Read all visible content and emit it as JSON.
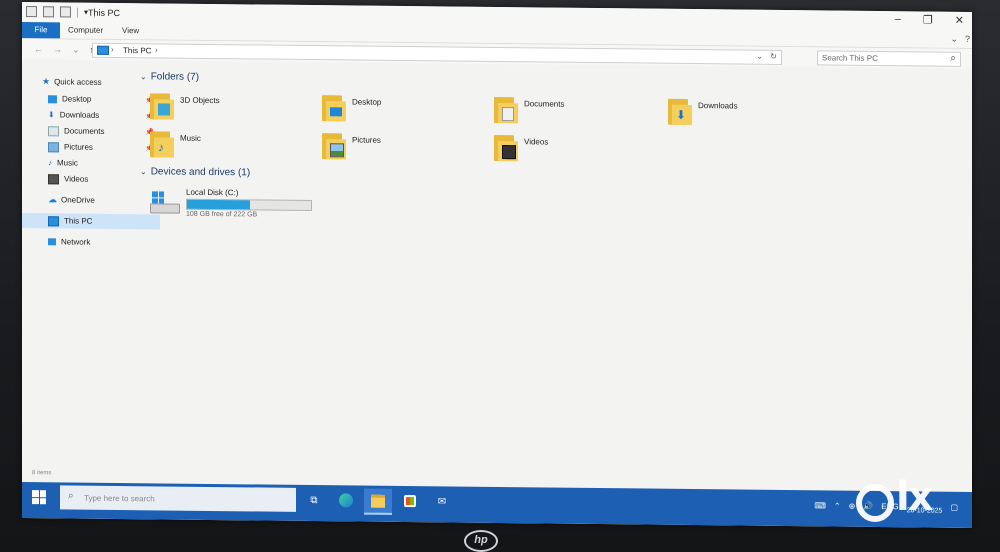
{
  "window": {
    "title": "This PC",
    "controls": [
      "minimize-icon",
      "maximize-icon",
      "close-icon"
    ]
  },
  "ribbon": {
    "tabs": [
      "File",
      "Computer",
      "View"
    ]
  },
  "address": {
    "path": "This PC",
    "search_placeholder": "Search This PC"
  },
  "sidebar": {
    "items": [
      {
        "label": "Quick access",
        "icon": "star-icon"
      },
      {
        "label": "Desktop",
        "icon": "desktop-icon",
        "pinned": true
      },
      {
        "label": "Downloads",
        "icon": "download-icon",
        "pinned": true
      },
      {
        "label": "Documents",
        "icon": "documents-icon",
        "pinned": true
      },
      {
        "label": "Pictures",
        "icon": "pictures-icon",
        "pinned": true
      },
      {
        "label": "Music",
        "icon": "music-icon"
      },
      {
        "label": "Videos",
        "icon": "videos-icon"
      },
      {
        "label": "OneDrive",
        "icon": "cloud-icon"
      },
      {
        "label": "This PC",
        "icon": "pc-icon",
        "selected": true
      },
      {
        "label": "Network",
        "icon": "network-icon"
      }
    ]
  },
  "main": {
    "folders_header": "Folders (7)",
    "folders": [
      {
        "label": "3D Objects",
        "icon": "3d-objects-icon"
      },
      {
        "label": "Desktop",
        "icon": "desktop-folder-icon"
      },
      {
        "label": "Documents",
        "icon": "documents-folder-icon"
      },
      {
        "label": "Downloads",
        "icon": "downloads-folder-icon"
      },
      {
        "label": "Music",
        "icon": "music-folder-icon"
      },
      {
        "label": "Pictures",
        "icon": "pictures-folder-icon"
      },
      {
        "label": "Videos",
        "icon": "videos-folder-icon"
      }
    ],
    "drives_header": "Devices and drives (1)",
    "drives": [
      {
        "label": "Local Disk (C:)",
        "free_text": "108 GB free of 222 GB",
        "used_fraction": 0.51
      }
    ]
  },
  "status": {
    "items_count": "8 items"
  },
  "taskbar": {
    "search_placeholder": "Type here to search",
    "apps": [
      "task-view-icon",
      "edge-icon",
      "file-explorer-icon",
      "store-icon",
      "mail-icon"
    ],
    "language": "ENG",
    "date": "28-10-2025"
  },
  "watermark": "olx",
  "brand": "hp",
  "colors": {
    "accent": "#1a6fc4",
    "taskbar": "#1c5fb3",
    "drive_fill": "#26a0da",
    "folder": "#f5cf5c"
  }
}
